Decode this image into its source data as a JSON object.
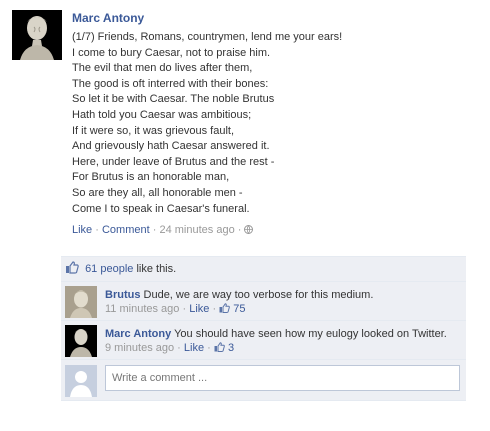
{
  "post": {
    "author": "Marc Antony",
    "lines": [
      "(1/7) Friends, Romans, countrymen, lend me your ears!",
      "I come to bury Caesar, not to praise him.",
      "The evil that men do lives after them,",
      "The good is oft interred with their bones:",
      "So let it be with Caesar. The noble Brutus",
      "Hath told you Caesar was ambitious;",
      "If it were so, it was grievous fault,",
      "And grievously hath Caesar answered it.",
      "Here, under leave of Brutus and the rest -",
      "For Brutus is an honorable man,",
      "So are they all, all honorable men -",
      "Come I to speak in Caesar's funeral."
    ],
    "like_link": "Like",
    "comment_link": "Comment",
    "timestamp": "24 minutes ago",
    "separator": "·"
  },
  "likes": {
    "people_link": "61 people",
    "suffix": " like this."
  },
  "comments": [
    {
      "author": "Brutus",
      "text": " Dude, we are way too verbose for this medium.",
      "timestamp": "11 minutes ago",
      "like_link": "Like",
      "like_count": "75"
    },
    {
      "author": "Marc Antony",
      "text": " You should have seen how my eulogy looked on Twitter.",
      "timestamp": "9 minutes ago",
      "like_link": "Like",
      "like_count": "3"
    }
  ],
  "write_comment": {
    "placeholder": "Write a comment ..."
  },
  "colors": {
    "link": "#3b5998",
    "feedback_bg": "#edeff4",
    "meta": "#999999"
  }
}
